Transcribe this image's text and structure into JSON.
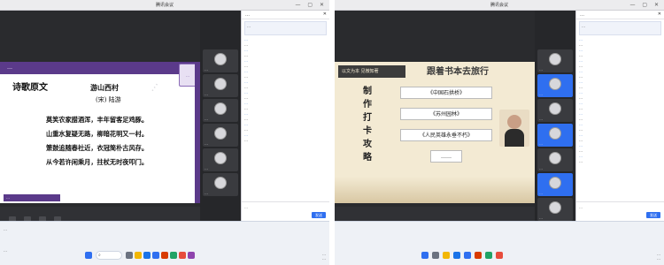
{
  "left": {
    "window_title": "腾讯会议",
    "chat_header": "…",
    "chat_notice": "…",
    "chat_placeholder": "…",
    "send_label": "发送",
    "slide": {
      "school_name": "…",
      "heading": "诗歌原文",
      "poem_title": "游山西村",
      "poem_author": "(宋) 陆游",
      "poem_lines": [
        "莫笑农家腊酒浑，丰年留客足鸡豚。",
        "山重水复疑无路，柳暗花明又一村。",
        "箫鼓追随春社近，衣冠简朴古风存。",
        "从今若许闲乘月，拄杖无时夜叩门。"
      ],
      "watermark": "…",
      "logo_text": "…"
    },
    "participants": [
      "…",
      "…",
      "…",
      "…",
      "…",
      "…"
    ],
    "chat_messages": [
      {
        "name": "…",
        "text": "…"
      },
      {
        "name": "…",
        "text": "…"
      },
      {
        "name": "…",
        "text": "…"
      },
      {
        "name": "…",
        "text": "…"
      },
      {
        "name": "…",
        "text": "…"
      },
      {
        "name": "…",
        "text": "…"
      },
      {
        "name": "…",
        "text": "…"
      },
      {
        "name": "…",
        "text": "…"
      },
      {
        "name": "…",
        "text": "…"
      },
      {
        "name": "…",
        "text": "…"
      }
    ],
    "taskbar": {
      "weather": "…",
      "window_label": "…",
      "clock": "…",
      "date": "…"
    }
  },
  "right": {
    "window_title": "腾讯会议",
    "chat_header": "…",
    "chat_notice": "…",
    "chat_placeholder": "…",
    "send_label": "发送",
    "slide": {
      "slogan": "以文为本 见微知著",
      "heading": "跟着书本去旅行",
      "vertical_title": [
        "制",
        "作",
        "打",
        "卡",
        "攻",
        "略"
      ],
      "books": [
        "《中国石拱桥》",
        "《苏州园林》",
        "《人民英雄永垂不朽》",
        "……"
      ]
    },
    "participants": [
      "…",
      "…",
      "…",
      "…",
      "…",
      "…",
      "…"
    ],
    "chat_messages": [
      {
        "name": "…",
        "text": "…"
      },
      {
        "name": "…",
        "text": "…"
      },
      {
        "name": "…",
        "text": "…"
      },
      {
        "name": "…",
        "text": "…"
      },
      {
        "name": "…",
        "text": "…"
      },
      {
        "name": "…",
        "text": "…"
      },
      {
        "name": "…",
        "text": "…"
      },
      {
        "name": "…",
        "text": "…"
      },
      {
        "name": "…",
        "text": "…"
      },
      {
        "name": "…",
        "text": "…"
      },
      {
        "name": "…",
        "text": "…"
      },
      {
        "name": "…",
        "text": "…"
      }
    ],
    "taskbar": {
      "clock": "…",
      "date": "…"
    }
  },
  "colors": {
    "accent_blue": "#2f6ff0",
    "slide_purple": "#5b3a8a",
    "parchment": "#f3ead3"
  },
  "icons": [
    "search-icon",
    "close-icon",
    "minimize-icon",
    "send-icon",
    "windows-start-icon"
  ]
}
